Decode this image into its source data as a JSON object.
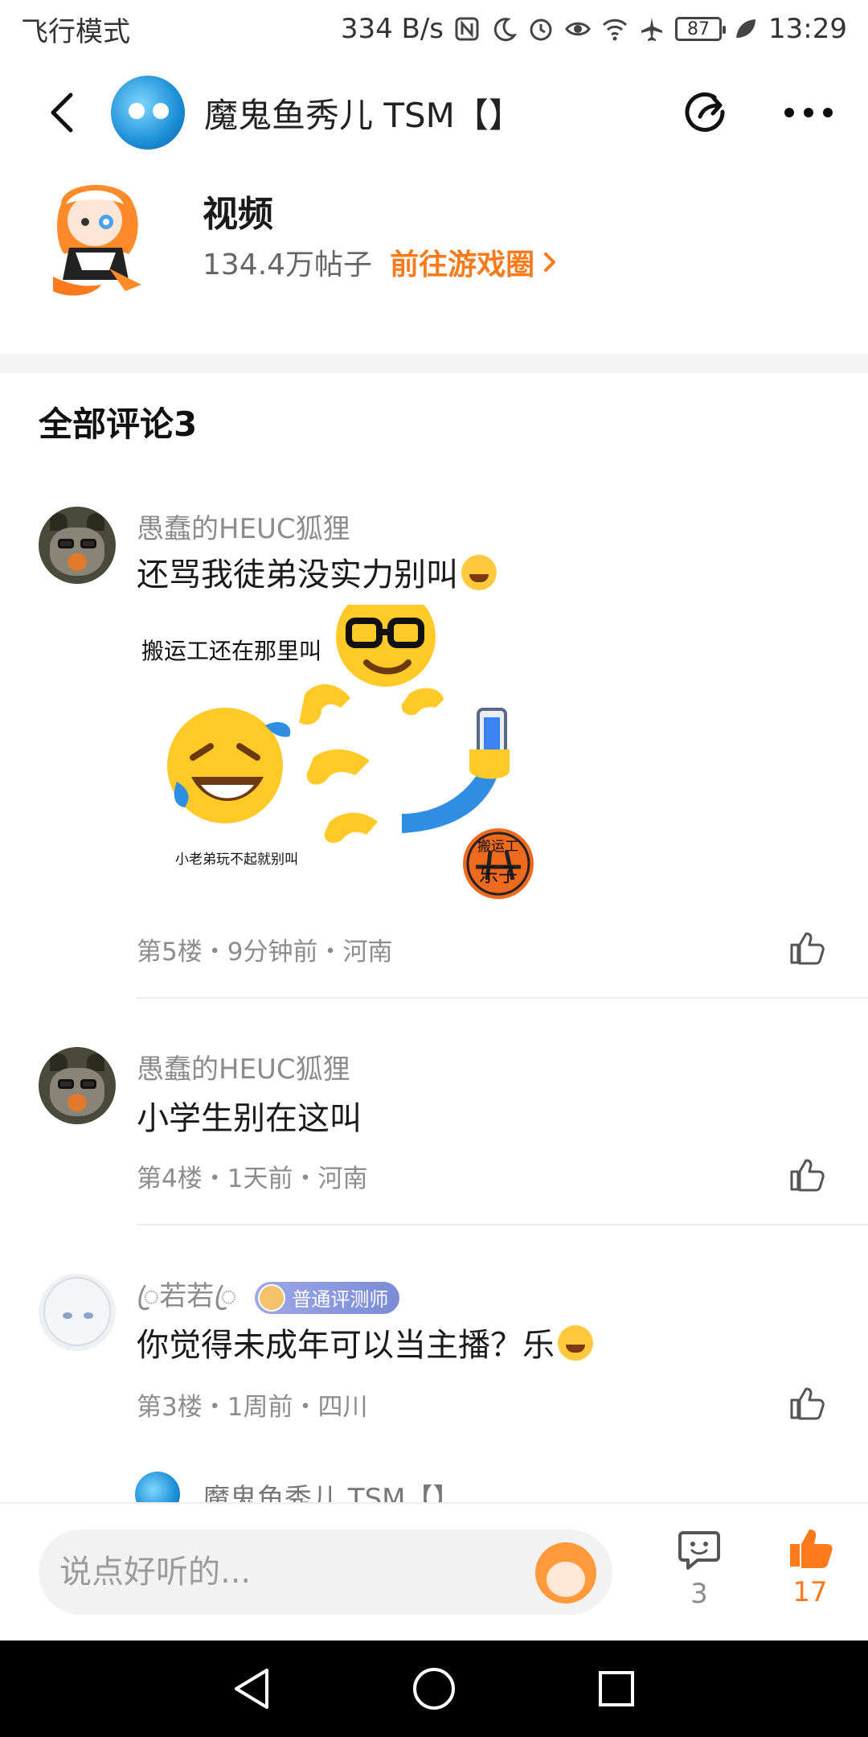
{
  "status_bar": {
    "mode": "飞行模式",
    "speed": "334 B/s",
    "battery": "87",
    "time": "13:29",
    "icons": [
      "nfc-icon",
      "moon-icon",
      "alarm-icon",
      "eye-icon",
      "wifi-icon",
      "airplane-icon",
      "battery-icon",
      "leaf-icon"
    ]
  },
  "header": {
    "title": "魔鬼鱼秀儿 TSM【】"
  },
  "circle": {
    "name": "视频",
    "count": "134.4万帖子",
    "link": "前往游戏圈"
  },
  "comments_section": {
    "title": "全部评论3"
  },
  "comments": [
    {
      "author": "愚蠢的HEUC狐狸",
      "text": "还骂我徒弟没实力别叫",
      "meta": "第5楼・9分钟前・河南",
      "image_captions": {
        "top": "搬运工还在那里叫",
        "bottom": "小老弟玩不起就别叫",
        "stamp": "搬运工",
        "stamp_big": "乐子"
      }
    },
    {
      "author": "愚蠢的HEUC狐狸",
      "text": "小学生别在这叫",
      "meta": "第4楼・1天前・河南"
    },
    {
      "author": "ꦿ若若ꦿ",
      "badge": "普通评测师",
      "text": "你觉得未成年可以当主播？乐",
      "meta": "第3楼・1周前・四川"
    }
  ],
  "peek": {
    "author": "魔鬼鱼秀儿 TSM【】"
  },
  "input_bar": {
    "placeholder": "说点好听的...",
    "comment_count": "3",
    "like_count": "17"
  },
  "colors": {
    "accent": "#ff7a1a",
    "muted": "#8c8c8c",
    "divider": "#f3f3f3"
  }
}
